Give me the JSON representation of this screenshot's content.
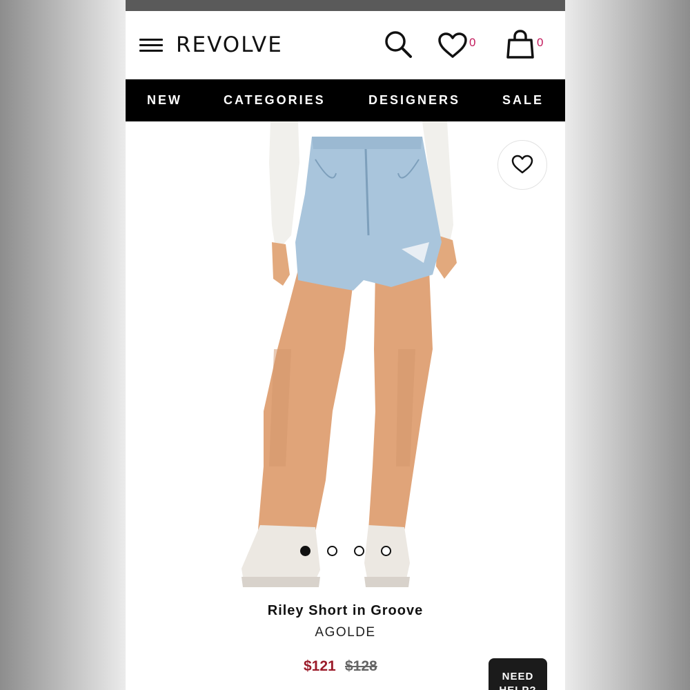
{
  "brand_logo": "REVOLVE",
  "header": {
    "wishlist_count": "0",
    "bag_count": "0"
  },
  "nav": {
    "items": [
      "NEW",
      "CATEGORIES",
      "DESIGNERS",
      "SALE"
    ]
  },
  "product": {
    "title": "Riley Short in Groove",
    "brand": "AGOLDE",
    "sale_price": "$121",
    "original_price": "$128",
    "carousel_active_index": 0,
    "carousel_count": 4
  },
  "help_button": {
    "label": "NEED HELP?"
  },
  "colors": {
    "nav_background": "#000000",
    "sale_price": "#9b1b2a",
    "badge": "#c2185b"
  },
  "icons": [
    "menu-icon",
    "search-icon",
    "heart-icon",
    "shopping-bag-icon"
  ]
}
